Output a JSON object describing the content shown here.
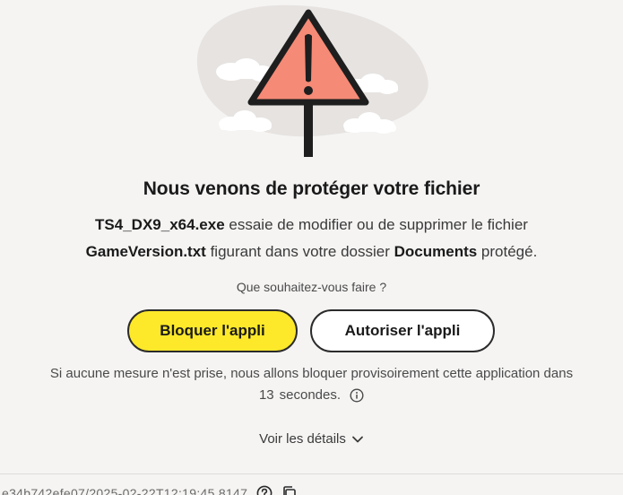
{
  "title": "Nous venons de protéger votre fichier",
  "message": {
    "app_name": "TS4_DX9_x64.exe",
    "part1": " essaie de modifier ou de supprimer le fichier",
    "file_name": "GameVersion.txt",
    "part2": " figurant dans votre dossier ",
    "folder_name": "Documents",
    "part3": " protégé."
  },
  "question": "Que souhaitez-vous faire ?",
  "buttons": {
    "block_label": "Bloquer l'appli",
    "allow_label": "Autoriser l'appli"
  },
  "countdown": {
    "line1": "Si aucune mesure n'est prise, nous allons bloquer provisoirement cette application dans",
    "seconds": "13",
    "unit": "secondes."
  },
  "details_label": "Voir les détails",
  "footer": {
    "id_text": "e34b742efe07/2025-02-22T12:19:45.8147"
  },
  "colors": {
    "warning_fill": "#f58a76",
    "block_button": "#fde92a",
    "blob": "#e6e3e1"
  },
  "icons": {
    "warning": "warning-triangle-icon",
    "info": "info-icon",
    "chevron": "chevron-down-icon",
    "help": "help-icon",
    "copy": "copy-icon"
  }
}
